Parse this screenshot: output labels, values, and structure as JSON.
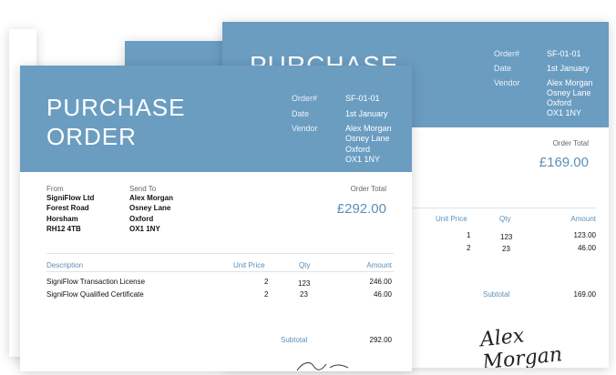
{
  "back": {
    "title": "PURCHASE",
    "order_no_label": "Order#",
    "order_no": "SF-01-01",
    "date_label": "Date",
    "date": "1st January",
    "vendor_label": "Vendor",
    "vendor_lines": [
      "Alex Morgan",
      "Osney Lane",
      "Oxford",
      "OX1 1NY"
    ],
    "order_total_label": "Order Total",
    "order_total": "£169.00",
    "columns": {
      "unit_price": "Unit Price",
      "qty": "Qty",
      "amount": "Amount"
    },
    "rows": [
      {
        "unit_price": "1",
        "qty": "123",
        "amount": "123.00"
      },
      {
        "unit_price": "2",
        "qty": "23",
        "amount": "46.00"
      }
    ],
    "subtotal_label": "Subtotal",
    "subtotal": "169.00",
    "signature": "Alex Morgan"
  },
  "front": {
    "title_line1": "PURCHASE",
    "title_line2": "ORDER",
    "order_no_label": "Order#",
    "order_no": "SF-01-01",
    "date_label": "Date",
    "date": "1st January",
    "vendor_label": "Vendor",
    "vendor_lines": [
      "Alex Morgan",
      "Osney Lane",
      "Oxford",
      "OX1 1NY"
    ],
    "from_label": "From",
    "from_lines": [
      "SigniFlow Ltd",
      "Forest Road",
      "Horsham",
      "RH12 4TB"
    ],
    "send_to_label": "Send To",
    "send_to_lines": [
      "Alex Morgan",
      "Osney Lane",
      "Oxford",
      "OX1 1NY"
    ],
    "order_total_label": "Order Total",
    "order_total": "£292.00",
    "columns": {
      "description": "Description",
      "unit_price": "Unit Price",
      "qty": "Qty",
      "amount": "Amount"
    },
    "rows": [
      {
        "description": "SigniFlow Transaction License",
        "unit_price": "2",
        "qty": "123",
        "amount": "246.00"
      },
      {
        "description": "SigniFlow Qualified Certificate",
        "unit_price": "2",
        "qty": "23",
        "amount": "46.00"
      }
    ],
    "subtotal_label": "Subtotal",
    "subtotal": "292.00"
  }
}
